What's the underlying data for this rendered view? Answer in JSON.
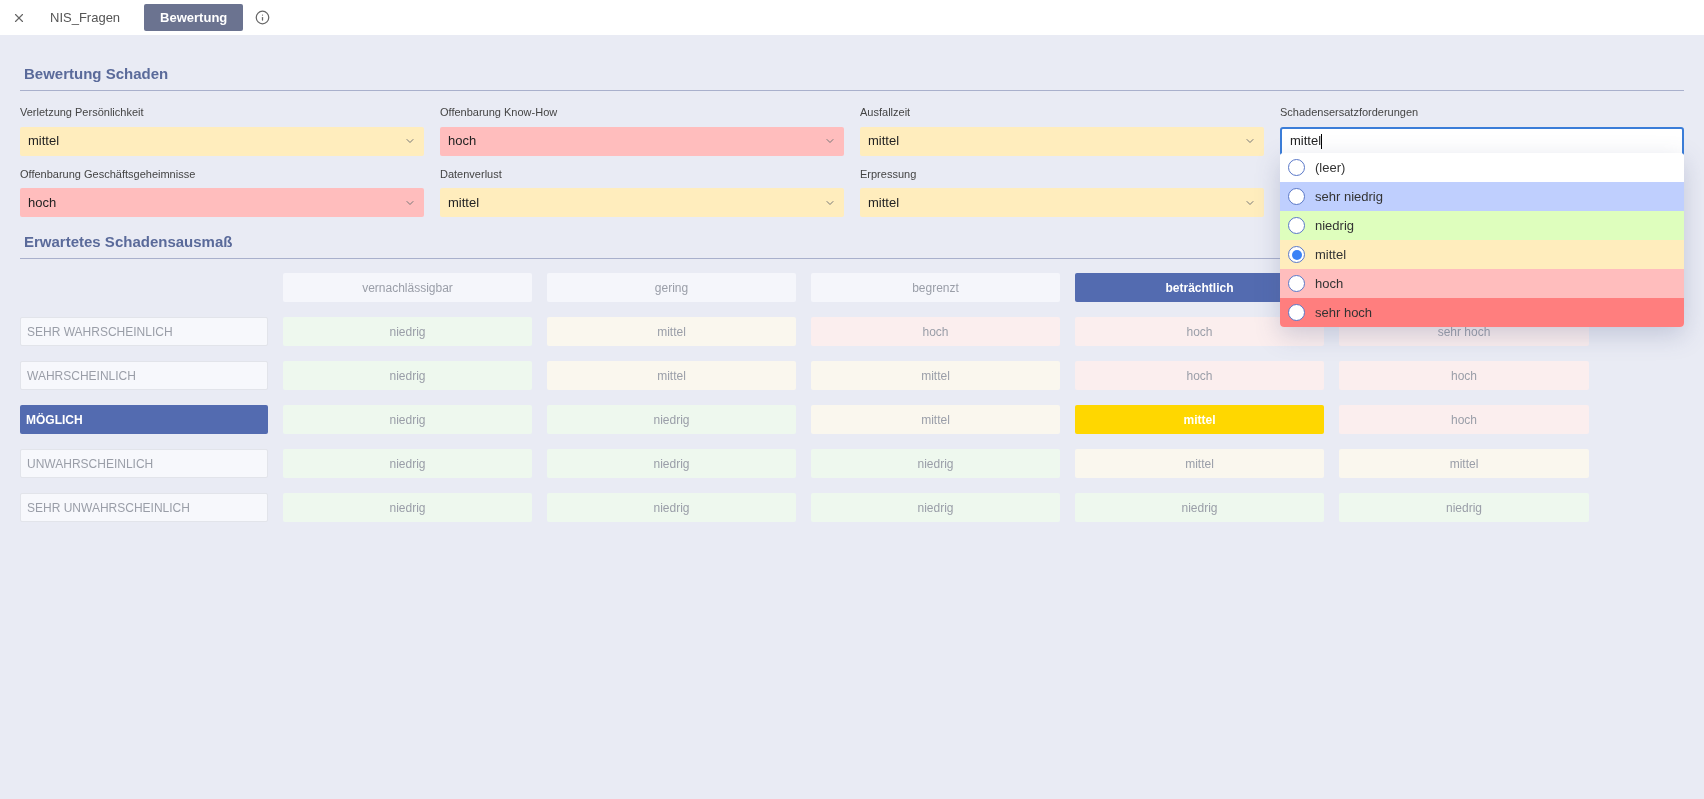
{
  "tabs": [
    {
      "label": "NIS_Fragen",
      "selected": false
    },
    {
      "label": "Bewertung",
      "selected": true
    }
  ],
  "bewertung_schaden": {
    "title": "Bewertung Schaden",
    "fields": [
      {
        "label": "Verletzung Persönlichkeit",
        "value": "mittel",
        "color": "#ffedbd"
      },
      {
        "label": "Offenbarung Know-How",
        "value": "hoch",
        "color": "#ffbdbd"
      },
      {
        "label": "Ausfallzeit",
        "value": "mittel",
        "color": "#ffedbd"
      },
      {
        "label": "Schadensersatzforderungen",
        "value": "mittel",
        "color": "#ffffff",
        "focused": true,
        "options": [
          {
            "label": "(leer)",
            "color": "#ffffff",
            "selected": false
          },
          {
            "label": "sehr niedrig",
            "color": "#bfcffe",
            "selected": false
          },
          {
            "label": "niedrig",
            "color": "#defebd",
            "selected": false
          },
          {
            "label": "mittel",
            "color": "#ffedbd",
            "selected": true
          },
          {
            "label": "hoch",
            "color": "#ffbdbd",
            "selected": false
          },
          {
            "label": "sehr hoch",
            "color": "#ff7e7e",
            "selected": false
          }
        ]
      },
      {
        "label": "Offenbarung Geschäftsgeheimnisse",
        "value": "hoch",
        "color": "#ffbdbd"
      },
      {
        "label": "Datenverlust",
        "value": "mittel",
        "color": "#ffedbd"
      },
      {
        "label": "Erpressung",
        "value": "mittel",
        "color": "#ffedbd"
      }
    ]
  },
  "schadensausmass": {
    "title": "Erwartetes Schadensausmaß",
    "columns": [
      {
        "label": "vernachlässigbar",
        "selected": false
      },
      {
        "label": "gering",
        "selected": false
      },
      {
        "label": "begrenzt",
        "selected": false
      },
      {
        "label": "beträchtlich",
        "selected": true
      }
    ],
    "rows": [
      {
        "label": "SEHR WAHRSCHEINLICH",
        "selected": false,
        "cells": [
          {
            "text": "niedrig",
            "kind": "low",
            "selected": false
          },
          {
            "text": "mittel",
            "kind": "medium",
            "selected": false
          },
          {
            "text": "hoch",
            "kind": "high",
            "selected": false
          },
          {
            "text": "hoch",
            "kind": "high",
            "selected": false
          },
          {
            "text": "sehr hoch",
            "kind": "high",
            "selected": false
          }
        ]
      },
      {
        "label": "WAHRSCHEINLICH",
        "selected": false,
        "cells": [
          {
            "text": "niedrig",
            "kind": "low",
            "selected": false
          },
          {
            "text": "mittel",
            "kind": "medium",
            "selected": false
          },
          {
            "text": "mittel",
            "kind": "medium",
            "selected": false
          },
          {
            "text": "hoch",
            "kind": "high",
            "selected": false
          },
          {
            "text": "hoch",
            "kind": "high",
            "selected": false
          }
        ]
      },
      {
        "label": "MÖGLICH",
        "selected": true,
        "cells": [
          {
            "text": "niedrig",
            "kind": "low",
            "selected": false
          },
          {
            "text": "niedrig",
            "kind": "low",
            "selected": false
          },
          {
            "text": "mittel",
            "kind": "medium",
            "selected": false
          },
          {
            "text": "mittel",
            "kind": "medium",
            "selected": true
          },
          {
            "text": "hoch",
            "kind": "high",
            "selected": false
          }
        ]
      },
      {
        "label": "UNWAHRSCHEINLICH",
        "selected": false,
        "cells": [
          {
            "text": "niedrig",
            "kind": "low",
            "selected": false
          },
          {
            "text": "niedrig",
            "kind": "low",
            "selected": false
          },
          {
            "text": "niedrig",
            "kind": "low",
            "selected": false
          },
          {
            "text": "mittel",
            "kind": "medium",
            "selected": false
          },
          {
            "text": "mittel",
            "kind": "medium",
            "selected": false
          }
        ]
      },
      {
        "label": "SEHR UNWAHRSCHEINLICH",
        "selected": false,
        "cells": [
          {
            "text": "niedrig",
            "kind": "low",
            "selected": false
          },
          {
            "text": "niedrig",
            "kind": "low",
            "selected": false
          },
          {
            "text": "niedrig",
            "kind": "low",
            "selected": false
          },
          {
            "text": "niedrig",
            "kind": "low",
            "selected": false
          },
          {
            "text": "niedrig",
            "kind": "low",
            "selected": false
          }
        ]
      }
    ]
  }
}
